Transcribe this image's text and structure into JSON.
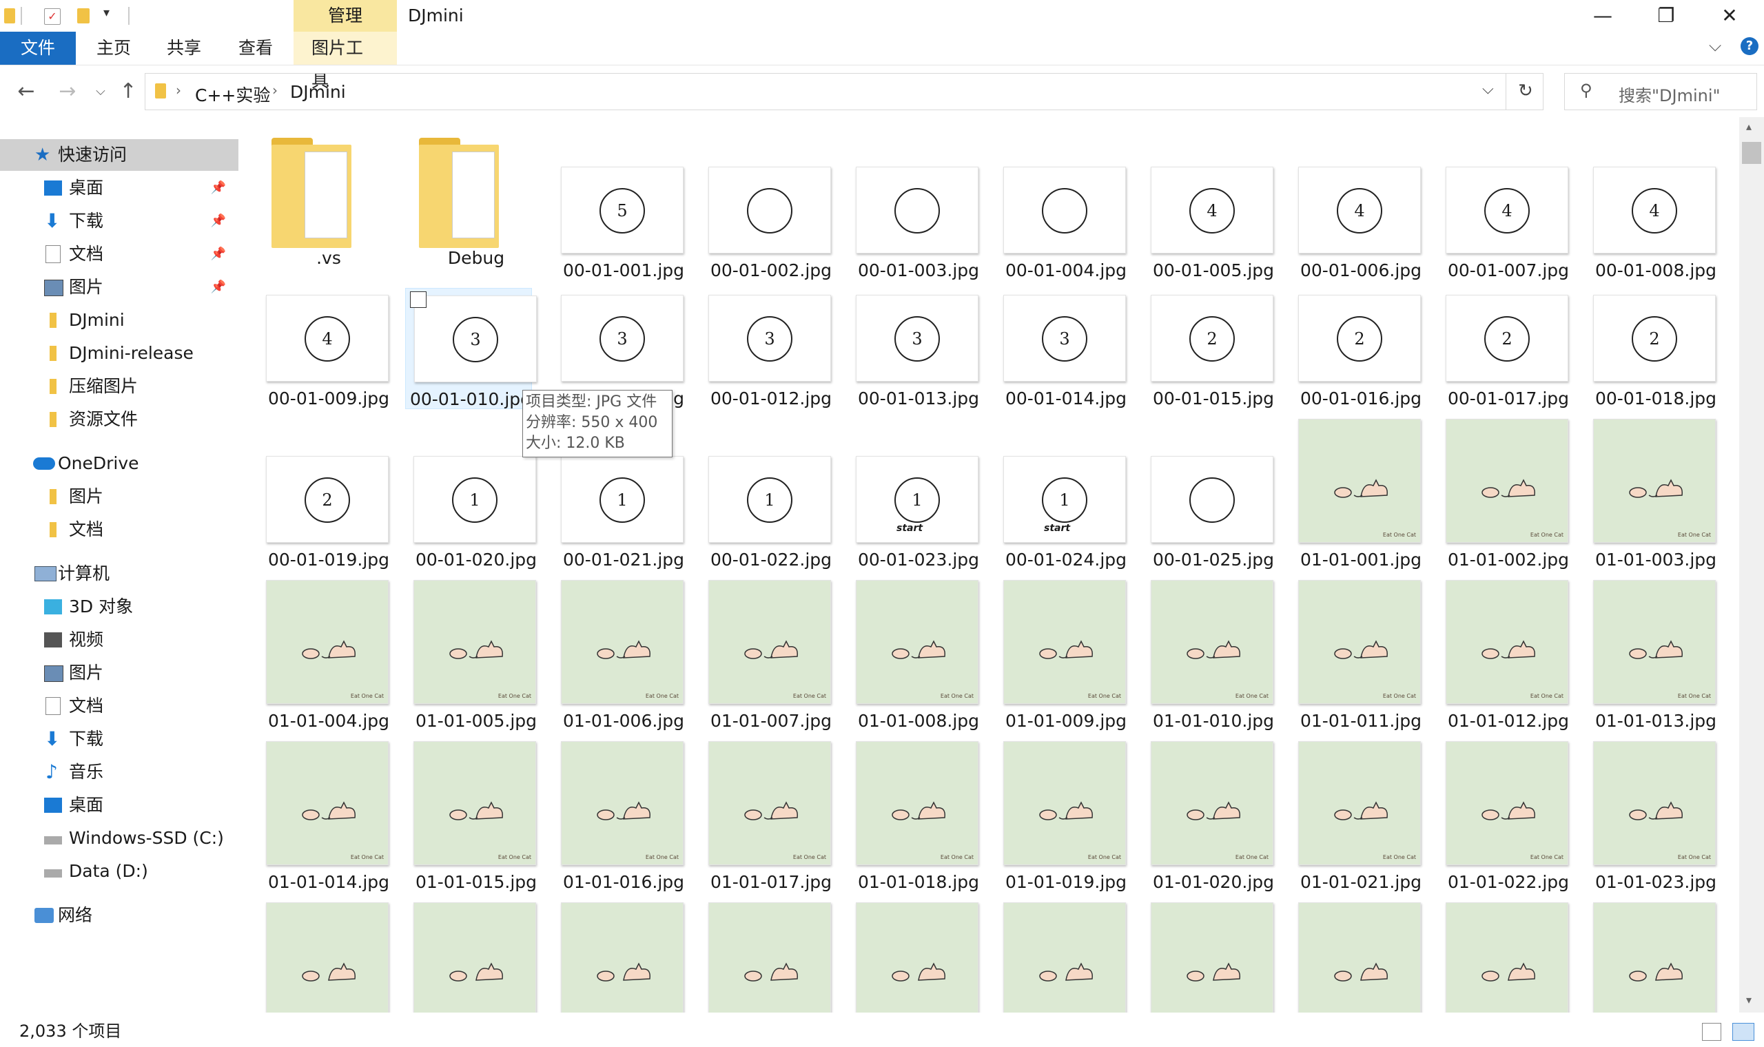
{
  "window": {
    "title": "DJmini",
    "manage_label": "管理",
    "minimize": "—",
    "restore": "❐",
    "close": "✕"
  },
  "ribbon": {
    "tabs": [
      "文件",
      "主页",
      "共享",
      "查看",
      "图片工具"
    ],
    "active_color": "#1a6dc2"
  },
  "address": {
    "crumbs": [
      "C++实验",
      "DJmini"
    ],
    "search_placeholder": "搜索\"DJmini\""
  },
  "sidebar": {
    "quick_access": "快速访问",
    "quick_items": [
      "桌面",
      "下载",
      "文档",
      "图片",
      "DJmini",
      "DJmini-release",
      "压缩图片",
      "资源文件"
    ],
    "onedrive": "OneDrive",
    "onedrive_items": [
      "图片",
      "文档"
    ],
    "computer": "计算机",
    "computer_items": [
      "3D 对象",
      "视频",
      "图片",
      "文档",
      "下载",
      "音乐",
      "桌面",
      "Windows-SSD (C:)",
      "Data (D:)"
    ],
    "network": "网络"
  },
  "folders": [
    ".vs",
    "Debug"
  ],
  "files": {
    "row1": [
      {
        "name": "00-01-001.jpg",
        "digit": "5"
      },
      {
        "name": "00-01-002.jpg",
        "digit": ""
      },
      {
        "name": "00-01-003.jpg",
        "digit": ""
      },
      {
        "name": "00-01-004.jpg",
        "digit": ""
      },
      {
        "name": "00-01-005.jpg",
        "digit": "4"
      },
      {
        "name": "00-01-006.jpg",
        "digit": "4"
      },
      {
        "name": "00-01-007.jpg",
        "digit": "4"
      },
      {
        "name": "00-01-008.jpg",
        "digit": "4"
      }
    ],
    "row2": [
      {
        "name": "00-01-009.jpg",
        "digit": "4"
      },
      {
        "name": "00-01-010.jpg",
        "digit": "3"
      },
      {
        "name": "00-01-011.jpg",
        "digit": "3"
      },
      {
        "name": "00-01-012.jpg",
        "digit": "3"
      },
      {
        "name": "00-01-013.jpg",
        "digit": "3"
      },
      {
        "name": "00-01-014.jpg",
        "digit": "3"
      },
      {
        "name": "00-01-015.jpg",
        "digit": "2"
      },
      {
        "name": "00-01-016.jpg",
        "digit": "2"
      },
      {
        "name": "00-01-017.jpg",
        "digit": "2"
      },
      {
        "name": "00-01-018.jpg",
        "digit": "2"
      }
    ],
    "row3_circles": [
      {
        "name": "00-01-019.jpg",
        "digit": "2"
      },
      {
        "name": "00-01-020.jpg",
        "digit": "1"
      },
      {
        "name": "00-01-021.jpg",
        "digit": "1"
      },
      {
        "name": "00-01-022.jpg",
        "digit": "1"
      },
      {
        "name": "00-01-023.jpg",
        "digit": "1",
        "start": "start"
      },
      {
        "name": "00-01-024.jpg",
        "digit": "1",
        "start": "start"
      },
      {
        "name": "00-01-025.jpg",
        "digit": ""
      }
    ],
    "row3_cats": [
      "01-01-001.jpg",
      "01-01-002.jpg",
      "01-01-003.jpg"
    ],
    "row4": [
      "01-01-004.jpg",
      "01-01-005.jpg",
      "01-01-006.jpg",
      "01-01-007.jpg",
      "01-01-008.jpg",
      "01-01-009.jpg",
      "01-01-010.jpg",
      "01-01-011.jpg",
      "01-01-012.jpg",
      "01-01-013.jpg"
    ],
    "row5": [
      "01-01-014.jpg",
      "01-01-015.jpg",
      "01-01-016.jpg",
      "01-01-017.jpg",
      "01-01-018.jpg",
      "01-01-019.jpg",
      "01-01-020.jpg",
      "01-01-021.jpg",
      "01-01-022.jpg",
      "01-01-023.jpg"
    ],
    "watermark": "Eat One Cat"
  },
  "tooltip": {
    "type": "项目类型: JPG 文件",
    "resolution": "分辨率: 550 x 400",
    "size": "大小: 12.0 KB"
  },
  "status": {
    "count": "2,033 个项目"
  }
}
